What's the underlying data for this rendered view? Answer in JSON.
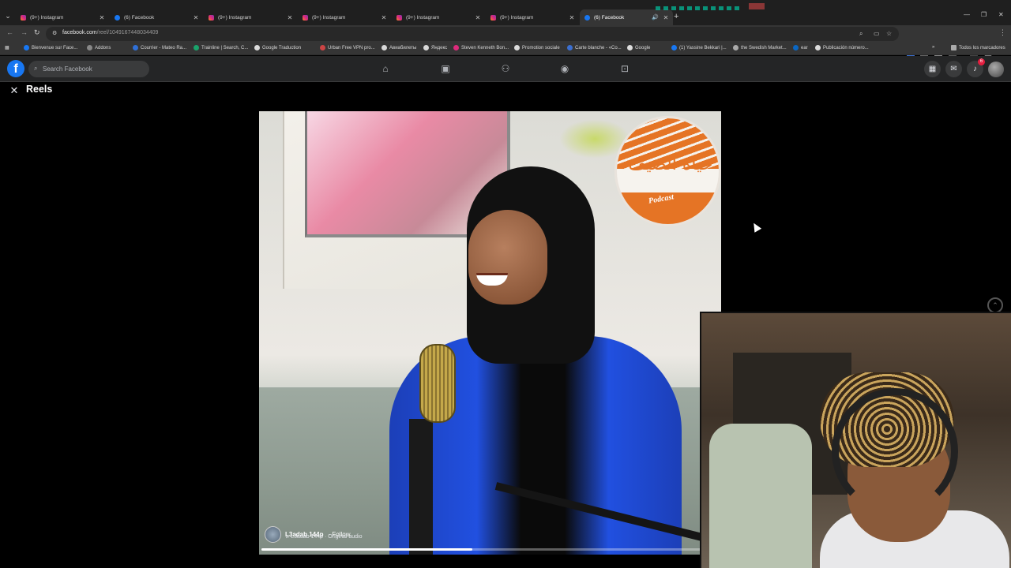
{
  "browser": {
    "tabs": [
      {
        "title": "(9+) Instagram",
        "icon": "instagram-icon",
        "kind": "ig"
      },
      {
        "title": "(6) Facebook",
        "icon": "facebook-icon",
        "kind": "fb"
      },
      {
        "title": "(9+) Instagram",
        "icon": "instagram-icon",
        "kind": "ig"
      },
      {
        "title": "(9+) Instagram",
        "icon": "instagram-icon",
        "kind": "ig"
      },
      {
        "title": "(9+) Instagram",
        "icon": "instagram-icon",
        "kind": "ig"
      },
      {
        "title": "(9+) Instagram",
        "icon": "instagram-icon",
        "kind": "ig"
      },
      {
        "title": "(6) Facebook",
        "icon": "facebook-icon",
        "kind": "fb",
        "active": true,
        "audio": true
      }
    ],
    "address": {
      "host": "facebook.com",
      "path": "/reel/1049167448034409"
    },
    "bookmarks": [
      "Bienvenue sur Face...",
      "Addons",
      "Courrier - Mateo Ra...",
      "Trainline | Search, C...",
      "Google Traduction",
      "Urban Free VPN pro...",
      "Авиабилеты",
      "Яндекс",
      "Steven Kenneth Bon...",
      "Promotion sociale",
      "Carte blanche - «Co...",
      "Google",
      "(1) Yassine Bekkari |...",
      "the Swedish Market...",
      "ear",
      "Publicación número..."
    ],
    "all_bookmarks": "Todos los marcadores"
  },
  "facebook": {
    "logo_letter": "f",
    "search_placeholder": "Search Facebook",
    "notification_count": "6",
    "nav_icons": [
      "home-icon",
      "reels-icon",
      "friends-icon",
      "groups-icon",
      "gaming-icon"
    ]
  },
  "reels": {
    "title": "Reels",
    "video": {
      "logo_text": "حياة الضيف",
      "logo_sub": "Podcast",
      "author": "L3adab 144p",
      "follow": "Follow",
      "audio": "L3adab 144p · Original audio",
      "progress": 0.46
    }
  },
  "colors": {
    "fb_blue": "#1877f2",
    "header_bg": "#242526",
    "badge_red": "#e41e3f",
    "podcast_orange": "#e57425"
  }
}
